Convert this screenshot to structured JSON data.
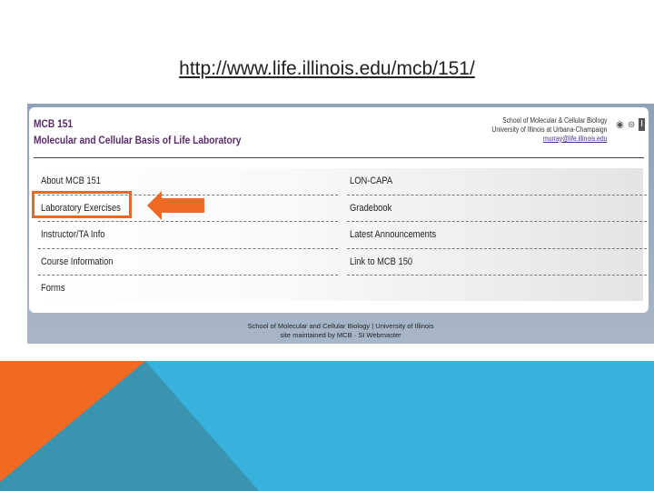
{
  "url": "http://www.life.illinois.edu/mcb/151/",
  "header": {
    "course": "MCB 151",
    "title": "Molecular and Cellular Basis of Life Laboratory",
    "school": "School of Molecular & Cellular Biology",
    "university": "University of Illinois at Urbana-Champaign",
    "email": "murray@life.illinois.edu"
  },
  "menu": {
    "left": [
      "About MCB 151",
      "Laboratory Exercises",
      "Instructor/TA Info",
      "Course Information",
      "Forms"
    ],
    "right": [
      "LON-CAPA",
      "Gradebook",
      "Latest Announcements",
      "Link to MCB 150"
    ]
  },
  "footer": {
    "line1": "School of Molecular and Cellular Biology | University of Illinois",
    "line2": "site maintained by MCB · SI Webmaster"
  },
  "colors": {
    "highlight": "#e86a22",
    "blue": "#38b1dc",
    "orange": "#f26a21",
    "teal": "#3a94b0"
  }
}
